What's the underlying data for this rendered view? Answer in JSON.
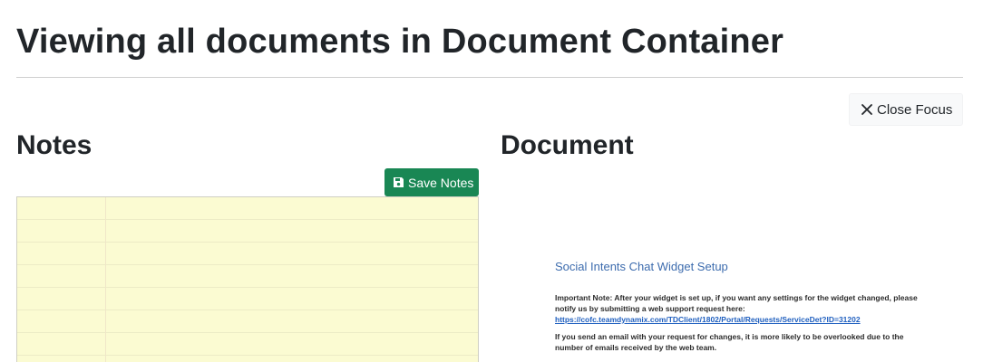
{
  "page": {
    "title": "Viewing all documents in Document Container"
  },
  "toolbar": {
    "close_focus_label": "Close Focus"
  },
  "notes": {
    "title": "Notes",
    "save_label": "Save Notes"
  },
  "document": {
    "title": "Document",
    "heading": "Social Intents Chat Widget Setup",
    "important_note": "Important Note: After your widget is set up, if you want any settings for the widget changed, please notify us by submitting a web support request here:",
    "link": "https://cofc.teamdynamix.com/TDClient/1802/Portal/Requests/ServiceDet?ID=31202",
    "email_note": "If you send an email with your request for changes, it is more likely to be overlooked due to the number of emails received by the web team."
  },
  "colors": {
    "save_button": "#198754",
    "notepad_background": "#fbfbd2",
    "doc_heading": "#3d6cae",
    "doc_link": "#1f5fbf"
  },
  "icons": {
    "close": "x-icon",
    "save": "floppy-disk-icon"
  }
}
